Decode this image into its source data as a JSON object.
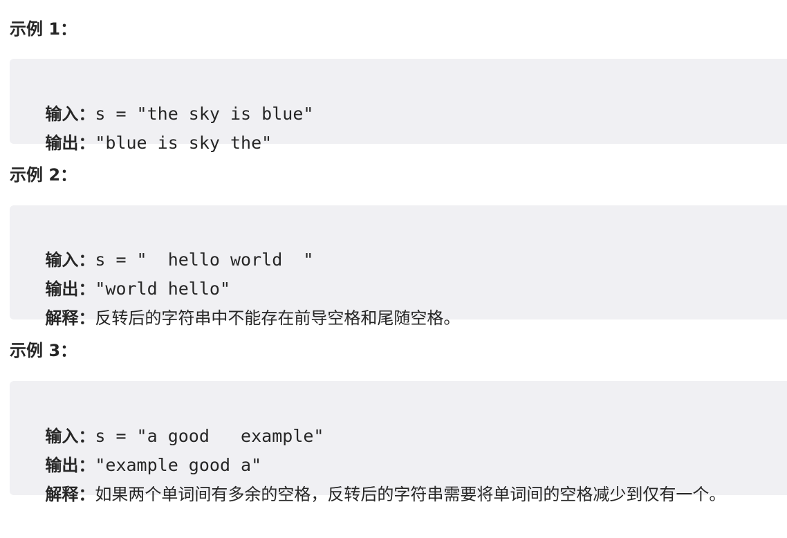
{
  "examples": [
    {
      "heading": "示例 1：",
      "lines": [
        {
          "label": "输入：",
          "value": "s = \"the sky is blue\""
        },
        {
          "label": "输出：",
          "value": "\"blue is sky the\""
        }
      ]
    },
    {
      "heading": "示例 2：",
      "lines": [
        {
          "label": "输入：",
          "value": "s = \"  hello world  \""
        },
        {
          "label": "输出：",
          "value": "\"world hello\""
        },
        {
          "label": "解释：",
          "value": "反转后的字符串中不能存在前导空格和尾随空格。"
        }
      ]
    },
    {
      "heading": "示例 3：",
      "lines": [
        {
          "label": "输入：",
          "value": "s = \"a good   example\""
        },
        {
          "label": "输出：",
          "value": "\"example good a\""
        },
        {
          "label": "解释：",
          "value": "如果两个单词间有多余的空格，反转后的字符串需要将单词间的空格减少到仅有一个。"
        }
      ]
    }
  ],
  "colors": {
    "text": "#262626",
    "code_background": "#f0f0f3"
  }
}
